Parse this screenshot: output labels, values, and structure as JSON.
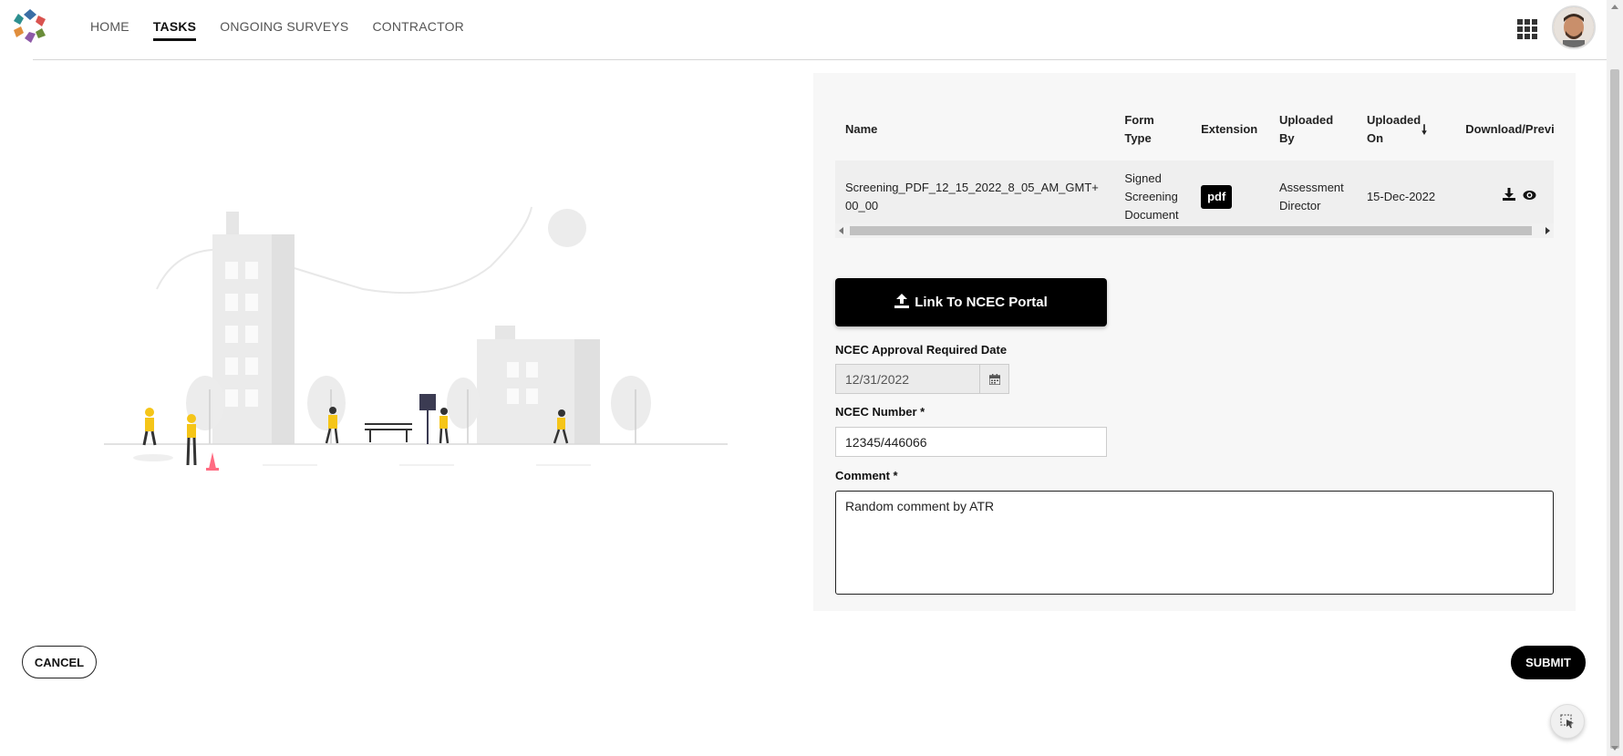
{
  "nav": {
    "items": [
      {
        "label": "HOME",
        "active": false
      },
      {
        "label": "TASKS",
        "active": true
      },
      {
        "label": "ONGOING SURVEYS",
        "active": false
      },
      {
        "label": "CONTRACTOR",
        "active": false
      }
    ]
  },
  "header": {
    "apps_icon": "grid-icon",
    "avatar": "user-avatar"
  },
  "files_table": {
    "columns": [
      "Name",
      "Form Type",
      "Extension",
      "Uploaded By",
      "Uploaded On",
      "Download/Preview"
    ],
    "sort_column": "Uploaded On",
    "sort_direction": "descending",
    "rows": [
      {
        "name": "Screening_PDF_12_15_2022_8_05_AM_GMT+00_00",
        "form_type": "Signed Screening Document",
        "extension": "pdf",
        "uploaded_by": "Assessment Director",
        "uploaded_on": "15-Dec-2022",
        "actions": [
          "download-icon",
          "eye-icon"
        ]
      }
    ]
  },
  "link_button": {
    "label": "Link To NCEC Portal",
    "icon": "upload-icon"
  },
  "approval_date": {
    "label": "NCEC Approval Required Date",
    "value": "12/31/2022",
    "icon": "calendar-icon"
  },
  "ncec_number": {
    "label": "NCEC Number *",
    "value": "12345/446066"
  },
  "comment": {
    "label": "Comment *",
    "value": "Random comment by ATR"
  },
  "actions": {
    "cancel_label": "CANCEL",
    "submit_label": "SUBMIT"
  },
  "colors": {
    "primary": "#000000",
    "panel_bg": "#f7f7f7",
    "accent_yellow": "#f5c518",
    "cone_pink": "#ff6b81"
  }
}
